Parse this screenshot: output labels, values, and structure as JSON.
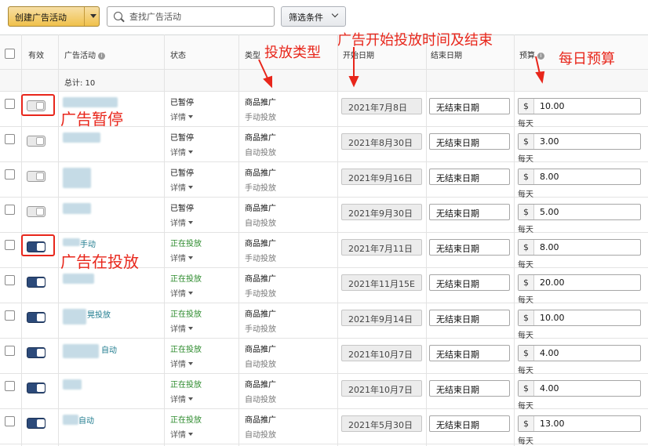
{
  "toolbar": {
    "create_label": "创建广告活动",
    "search_placeholder": "查找广告活动",
    "filter_label": "筛选条件"
  },
  "headers": {
    "enabled": "有效",
    "campaign": "广告活动",
    "status": "状态",
    "type": "类型",
    "start": "开始日期",
    "end": "结束日期",
    "budget": "预算"
  },
  "total_label": "总计: 10",
  "rows": [
    {
      "on": false,
      "name": "",
      "status": "已暂停",
      "detail": "详情",
      "type": "商品推广",
      "targeting": "手动投放",
      "start": "2021年7月8日",
      "end": "无结束日期",
      "currency": "$",
      "budget": "10.00",
      "period": "每天"
    },
    {
      "on": false,
      "name": "",
      "status": "已暂停",
      "detail": "详情",
      "type": "商品推广",
      "targeting": "自动投放",
      "start": "2021年8月30日",
      "end": "无结束日期",
      "currency": "$",
      "budget": "3.00",
      "period": "每天"
    },
    {
      "on": false,
      "name": "",
      "status": "已暂停",
      "detail": "详情",
      "type": "商品推广",
      "targeting": "手动投放",
      "start": "2021年9月16日",
      "end": "无结束日期",
      "currency": "$",
      "budget": "8.00",
      "period": "每天"
    },
    {
      "on": false,
      "name": "",
      "status": "已暂停",
      "detail": "详情",
      "type": "商品推广",
      "targeting": "自动投放",
      "start": "2021年9月30日",
      "end": "无结束日期",
      "currency": "$",
      "budget": "5.00",
      "period": "每天"
    },
    {
      "on": true,
      "name": "手动",
      "status": "正在投放",
      "detail": "详情",
      "type": "商品推广",
      "targeting": "手动投放",
      "start": "2021年7月11日",
      "end": "无结束日期",
      "currency": "$",
      "budget": "8.00",
      "period": "每天"
    },
    {
      "on": true,
      "name": "",
      "status": "正在投放",
      "detail": "详情",
      "type": "商品推广",
      "targeting": "手动投放",
      "start": "2021年11月15E",
      "end": "无结束日期",
      "currency": "$",
      "budget": "20.00",
      "period": "每天"
    },
    {
      "on": true,
      "name": "晃投放",
      "status": "正在投放",
      "detail": "详情",
      "type": "商品推广",
      "targeting": "手动投放",
      "start": "2021年9月14日",
      "end": "无结束日期",
      "currency": "$",
      "budget": "10.00",
      "period": "每天"
    },
    {
      "on": true,
      "name": "自动",
      "status": "正在投放",
      "detail": "详情",
      "type": "商品推广",
      "targeting": "自动投放",
      "start": "2021年10月7日",
      "end": "无结束日期",
      "currency": "$",
      "budget": "4.00",
      "period": "每天"
    },
    {
      "on": true,
      "name": "",
      "status": "正在投放",
      "detail": "详情",
      "type": "商品推广",
      "targeting": "自动投放",
      "start": "2021年10月7日",
      "end": "无结束日期",
      "currency": "$",
      "budget": "4.00",
      "period": "每天"
    },
    {
      "on": true,
      "name": "自动",
      "status": "正在投放",
      "detail": "详情",
      "type": "商品推广",
      "targeting": "自动投放",
      "start": "2021年5月30日",
      "end": "无结束日期",
      "currency": "$",
      "budget": "13.00",
      "period": "每天"
    }
  ],
  "annotations": {
    "paused": "广告暂停",
    "running": "广告在投放",
    "type": "投放类型",
    "start_end": "广告开始投放时间及结束",
    "budget": "每日预算"
  },
  "colors": {
    "annotation": "#e8261b",
    "toggle_on": "#2c4a7a",
    "status_live": "#2b8a2b",
    "create_button": "#f0c14b"
  }
}
